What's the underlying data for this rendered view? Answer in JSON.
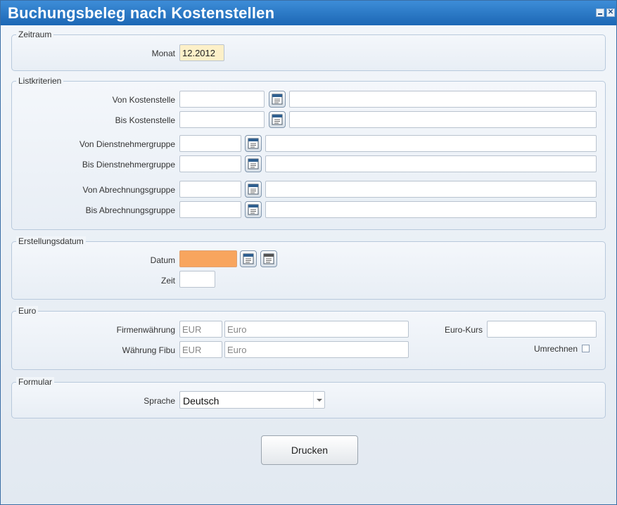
{
  "window": {
    "title": "Buchungsbeleg nach Kostenstellen",
    "close_glyph": "✕"
  },
  "zeitraum": {
    "legend": "Zeitraum",
    "monat_label": "Monat",
    "monat_value": "12.2012"
  },
  "listkriterien": {
    "legend": "Listkriterien",
    "von_kostenstelle": "Von Kostenstelle",
    "bis_kostenstelle": "Bis Kostenstelle",
    "von_dienstnehmergruppe": "Von Dienstnehmergruppe",
    "bis_dienstnehmergruppe": "Bis Dienstnehmergruppe",
    "von_abrechnungsgruppe": "Von Abrechnungsgruppe",
    "bis_abrechnungsgruppe": "Bis Abrechnungsgruppe"
  },
  "erstellungsdatum": {
    "legend": "Erstellungsdatum",
    "datum_label": "Datum",
    "zeit_label": "Zeit"
  },
  "euro": {
    "legend": "Euro",
    "firmenwaehrung_label": "Firmenwährung",
    "firmenwaehrung_code": "EUR",
    "firmenwaehrung_name": "Euro",
    "waehrung_fibu_label": "Währung Fibu",
    "waehrung_fibu_code": "EUR",
    "waehrung_fibu_name": "Euro",
    "euro_kurs_label": "Euro-Kurs",
    "umrechnen_label": "Umrechnen"
  },
  "formular": {
    "legend": "Formular",
    "sprache_label": "Sprache",
    "sprache_value": "Deutsch"
  },
  "actions": {
    "drucken_label": "Drucken"
  },
  "icons": {
    "lookup": "calendar-list-icon",
    "arrow": "chevron-down-icon"
  },
  "colors": {
    "title_bar": "#1c67b5",
    "month_field": "#fdf0c8",
    "date_field": "#f8a55e"
  }
}
